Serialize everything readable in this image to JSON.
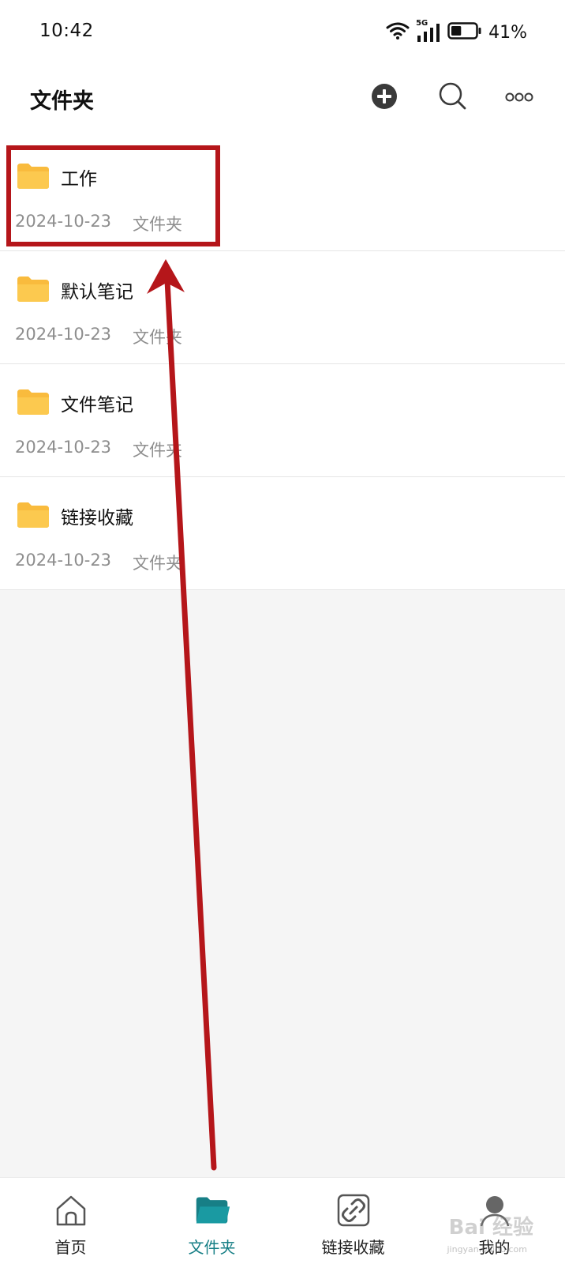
{
  "status_bar": {
    "time": "10:42",
    "network": "5G",
    "battery_percent": "41%",
    "battery_level": 0.41
  },
  "header": {
    "title": "文件夹",
    "icons": [
      "add-icon",
      "search-icon",
      "more-icon"
    ]
  },
  "folders": [
    {
      "name": "工作",
      "date": "2024-10-23",
      "type": "文件夹"
    },
    {
      "name": "默认笔记",
      "date": "2024-10-23",
      "type": "文件夹"
    },
    {
      "name": "文件笔记",
      "date": "2024-10-23",
      "type": "文件夹"
    },
    {
      "name": "链接收藏",
      "date": "2024-10-23",
      "type": "文件夹"
    }
  ],
  "bottom_nav": {
    "items": [
      {
        "label": "首页",
        "icon": "home-icon"
      },
      {
        "label": "文件夹",
        "icon": "folder-icon",
        "active": true
      },
      {
        "label": "链接收藏",
        "icon": "link-icon"
      },
      {
        "label": "我的",
        "icon": "profile-icon"
      }
    ]
  },
  "watermark": {
    "text": "Bai 经验",
    "sub": "jingyan.baidu.com"
  },
  "colors": {
    "accent": "#177f86",
    "folder": "#f9bb3d",
    "annotation": "#b5161a",
    "background": "#f5f5f5"
  }
}
